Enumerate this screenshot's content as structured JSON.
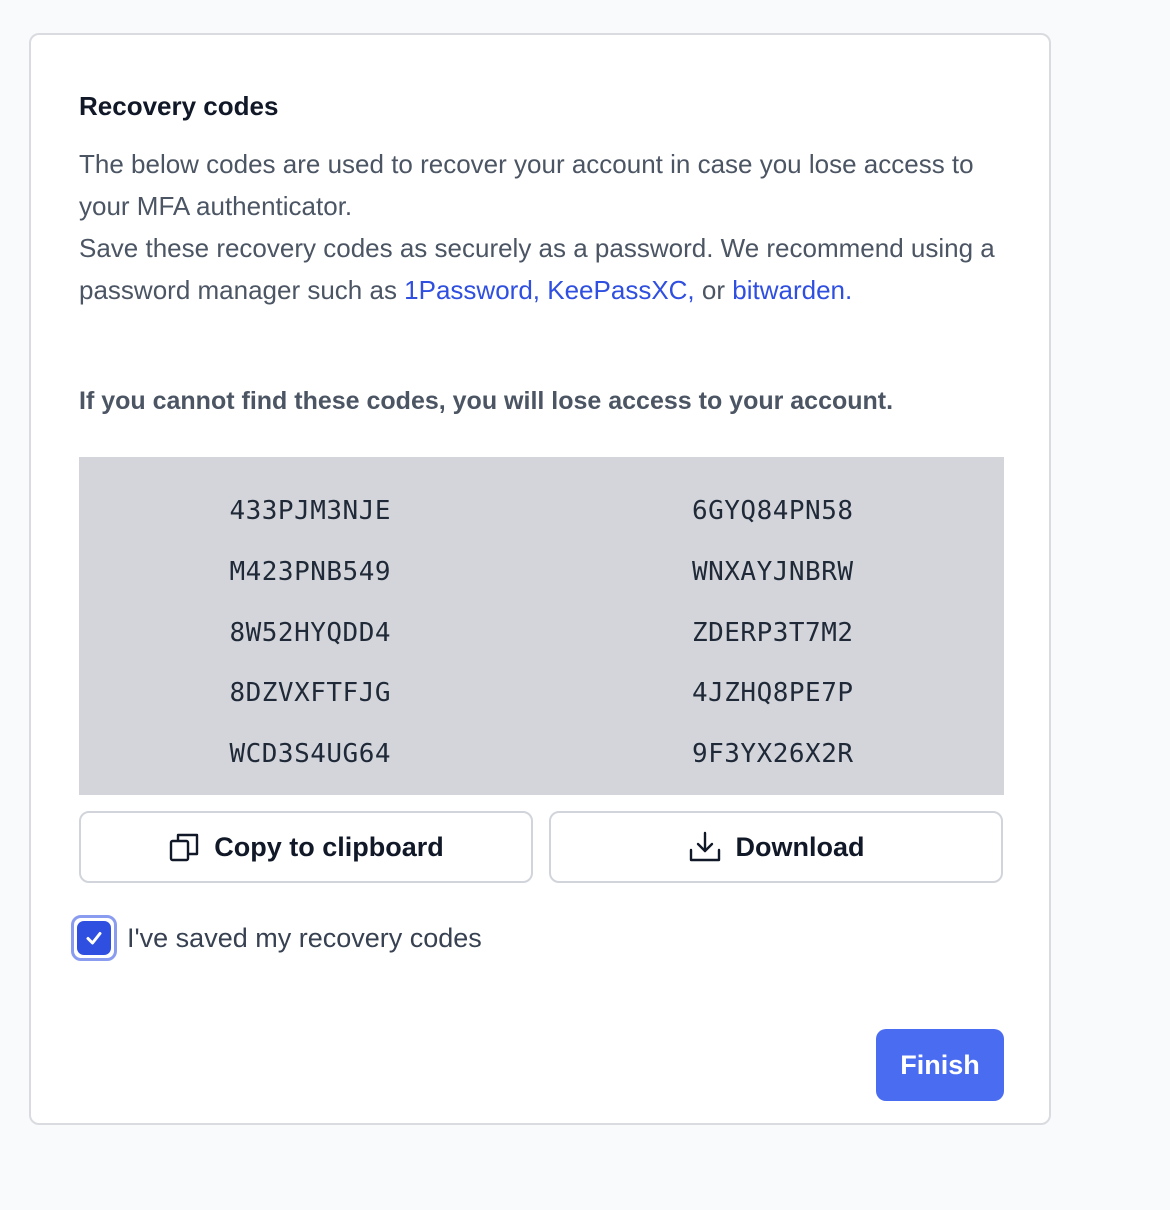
{
  "card": {
    "title": "Recovery codes",
    "description_line1": "The below codes are used to recover your account in case you lose access to your MFA authenticator.",
    "description_line2_prefix": "Save these recovery codes as securely as a password. We recommend using a password manager such as ",
    "links": [
      "1Password,",
      "KeePassXC,",
      "bitwarden."
    ],
    "description_or": "or",
    "warning": "If you cannot find these codes, you will lose access to your account."
  },
  "codes": [
    "433PJM3NJE",
    "6GYQ84PN58",
    "M423PNB549",
    "WNXAYJNBRW",
    "8W52HYQDD4",
    "ZDERP3T7M2",
    "8DZVXFTFJG",
    "4JZHQ8PE7P",
    "WCD3S4UG64",
    "9F3YX26X2R"
  ],
  "actions": {
    "copy_label": "Copy to clipboard",
    "copy_icon": "copy-icon",
    "download_label": "Download",
    "download_icon": "download-icon"
  },
  "confirm": {
    "label": "I've saved my recovery codes",
    "checked": true
  },
  "finish_label": "Finish",
  "colors": {
    "accent": "#4a6cf0",
    "link": "#2f4fe0",
    "codes_bg": "#d3d5db"
  }
}
